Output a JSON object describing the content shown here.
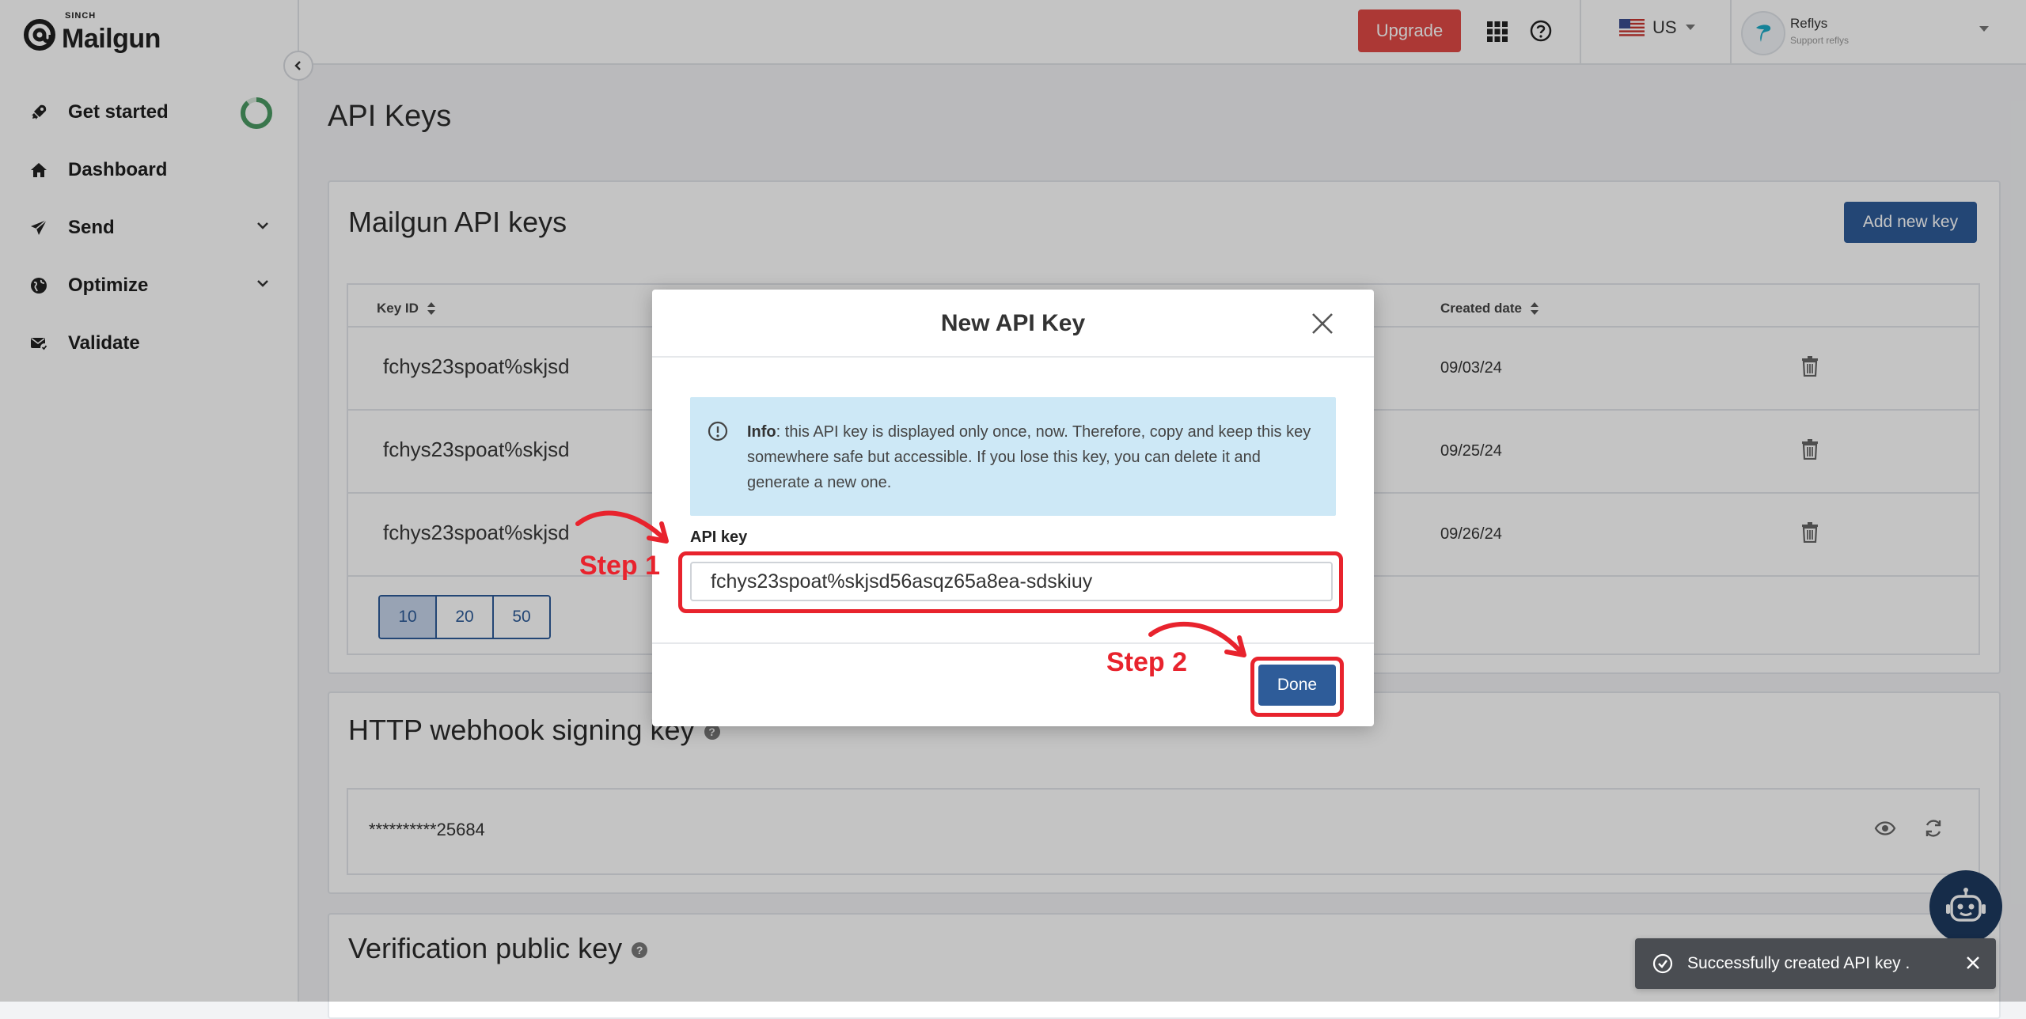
{
  "brand": {
    "sinch": "SINCH",
    "name": "Mailgun"
  },
  "sidebar": {
    "items": [
      {
        "label": "Get started",
        "icon": "rocket-icon"
      },
      {
        "label": "Dashboard",
        "icon": "home-icon"
      },
      {
        "label": "Send",
        "icon": "paper-plane-icon"
      },
      {
        "label": "Optimize",
        "icon": "globe-icon"
      },
      {
        "label": "Validate",
        "icon": "mail-check-icon"
      }
    ]
  },
  "header": {
    "upgrade_label": "Upgrade",
    "region": "US",
    "user_name": "Reflys",
    "user_sub": "Support reflys"
  },
  "page": {
    "title": "API Keys"
  },
  "api_keys_card": {
    "title": "Mailgun API keys",
    "add_button": "Add new key",
    "columns": {
      "key_id": "Key ID",
      "created": "Created date"
    },
    "rows": [
      {
        "key_id": "fchys23spoat%skjsd",
        "created": "09/03/24"
      },
      {
        "key_id": "fchys23spoat%skjsd",
        "created": "09/25/24"
      },
      {
        "key_id": "fchys23spoat%skjsd",
        "created": "09/26/24"
      }
    ],
    "page_sizes": [
      "10",
      "20",
      "50"
    ],
    "active_page_size": "10"
  },
  "webhook_card": {
    "title": "HTTP webhook signing key",
    "masked_value": "**********25684"
  },
  "verification_card": {
    "title": "Verification public key"
  },
  "modal": {
    "title": "New API Key",
    "info_bold": "Info",
    "info_text": ": this API key is displayed only once, now. Therefore, copy and keep this key somewhere safe but accessible. If you lose this key, you can delete it and generate a new one.",
    "api_key_label": "API key",
    "api_key_value": "fchys23spoat%skjsd56asqz65a8ea-sdskiuy",
    "done_label": "Done"
  },
  "annotations": {
    "step1": "Step 1",
    "step2": "Step 2",
    "color": "#e8232d"
  },
  "toast": {
    "message": "Successfully created API key ."
  },
  "colors": {
    "primary": "#2e5c99",
    "upgrade": "#e04a45",
    "info_bg": "#cde8f6"
  }
}
